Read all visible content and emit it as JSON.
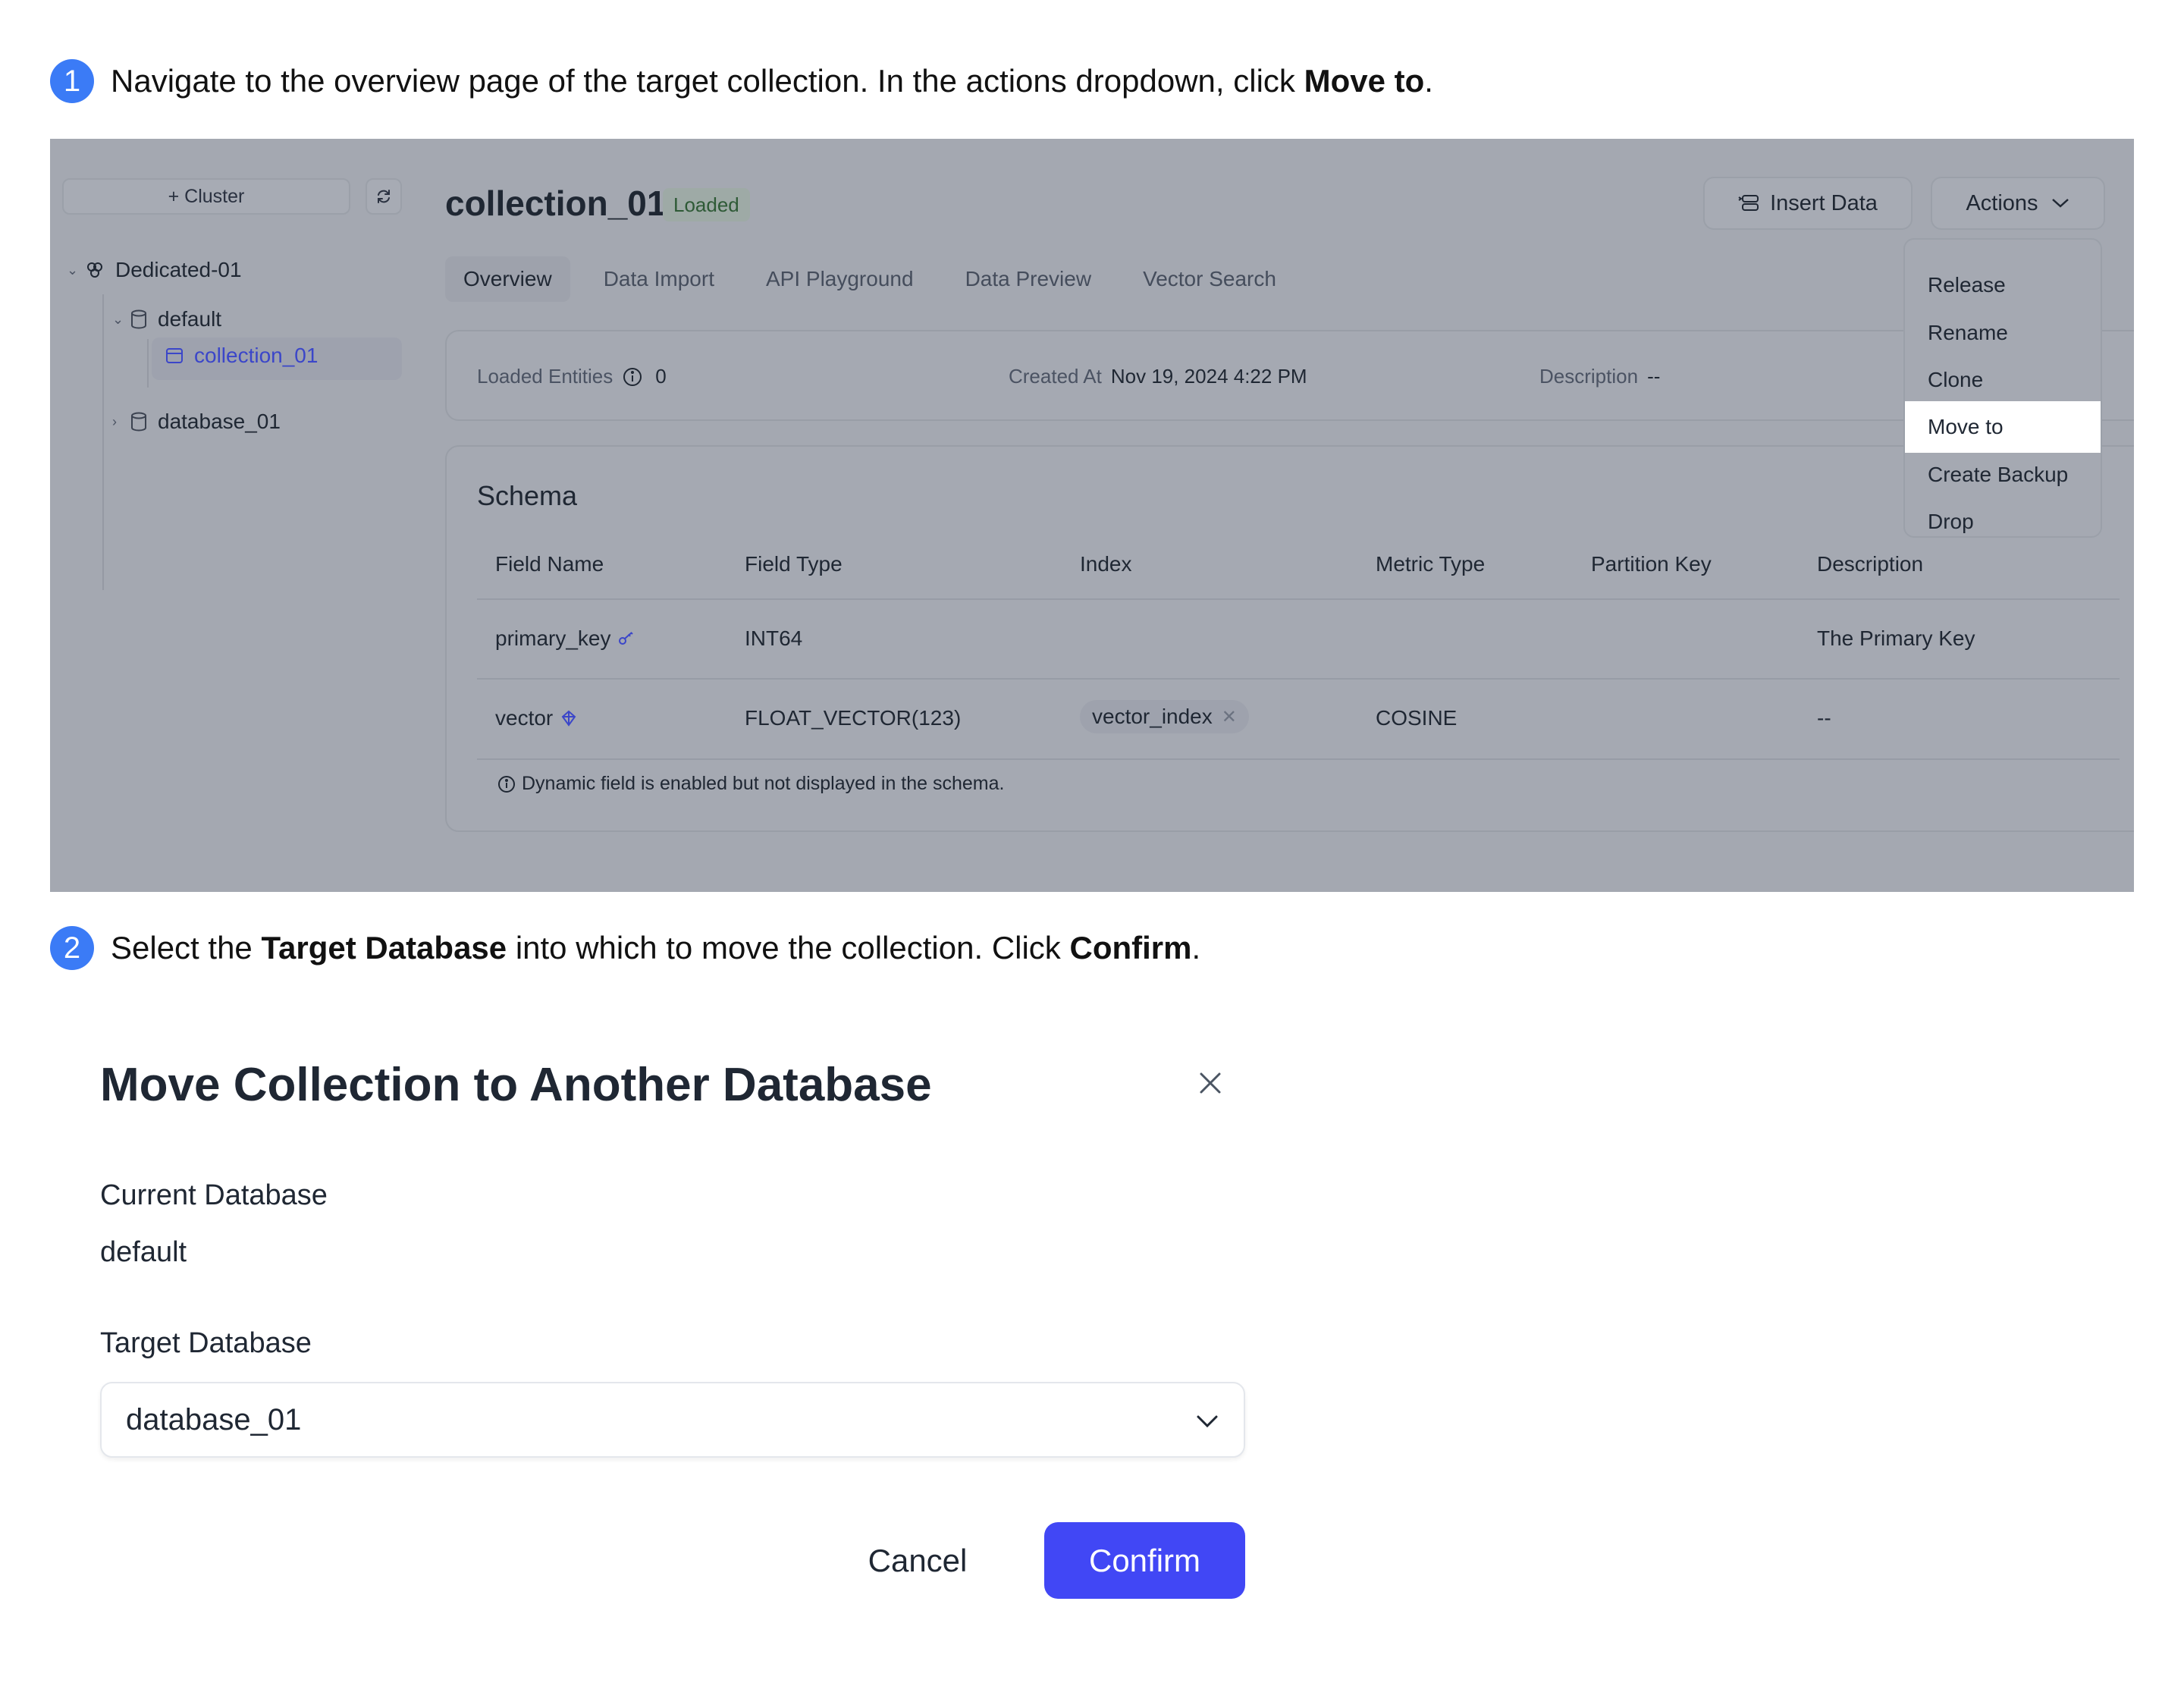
{
  "step1": {
    "number": "1",
    "text_before": "Navigate to the overview page of the target collection. In the actions dropdown, click ",
    "bold": "Move to",
    "text_after": "."
  },
  "step2": {
    "number": "2",
    "text_before": "Select the ",
    "bold1": "Target Database",
    "text_middle": " into which to move the collection. Click ",
    "bold2": "Confirm",
    "text_after": "."
  },
  "screenshot": {
    "sidebar": {
      "add_cluster_label": "+ Cluster",
      "refresh_icon": "refresh-icon",
      "tree": {
        "cluster": "Dedicated-01",
        "databases": [
          {
            "name": "default",
            "expanded": true,
            "collections": [
              {
                "name": "collection_01",
                "selected": true
              }
            ]
          },
          {
            "name": "database_01",
            "expanded": false,
            "collections": []
          }
        ]
      }
    },
    "header": {
      "collection_name": "collection_01",
      "status_badge": "Loaded",
      "insert_data_label": "Insert Data",
      "actions_label": "Actions"
    },
    "tabs": [
      "Overview",
      "Data Import",
      "API Playground",
      "Data Preview",
      "Vector Search"
    ],
    "active_tab": "Overview",
    "info": {
      "loaded_entities_label": "Loaded Entities",
      "loaded_entities_value": "0",
      "created_at_label": "Created At",
      "created_at_value": "Nov 19, 2024 4:22 PM",
      "description_label": "Description",
      "description_value": "--"
    },
    "schema": {
      "title": "Schema",
      "columns": [
        "Field Name",
        "Field Type",
        "Index",
        "Metric Type",
        "Partition Key",
        "Description"
      ],
      "rows": [
        {
          "field_name": "primary_key",
          "icon": "key-icon",
          "field_type": "INT64",
          "index": "",
          "metric_type": "",
          "partition_key": "",
          "description": "The Primary Key"
        },
        {
          "field_name": "vector",
          "icon": "vector-icon",
          "field_type": "FLOAT_VECTOR(123)",
          "index": "vector_index",
          "metric_type": "COSINE",
          "partition_key": "",
          "description": "--"
        }
      ],
      "note": "Dynamic field is enabled but not displayed in the schema."
    },
    "actions_menu": {
      "items": [
        "Release",
        "Rename",
        "Clone",
        "Move to",
        "Create Backup",
        "Drop"
      ],
      "highlighted": "Move to"
    }
  },
  "modal": {
    "title": "Move Collection to Another Database",
    "current_db_label": "Current Database",
    "current_db_value": "default",
    "target_db_label": "Target Database",
    "target_db_value": "database_01",
    "cancel_label": "Cancel",
    "confirm_label": "Confirm"
  },
  "colors": {
    "step_badge": "#3b7bf6",
    "confirm_button": "#4147f5",
    "overlay": "#a4a8b1",
    "selected_link": "#3b46c9"
  }
}
